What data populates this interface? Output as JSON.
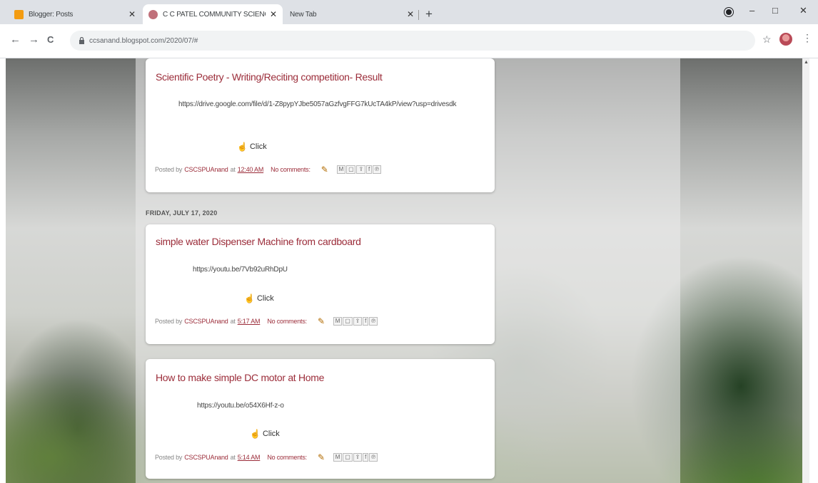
{
  "browser": {
    "tabs": [
      {
        "title": "Blogger: Posts",
        "favicon_color": "#f39c12",
        "active": false
      },
      {
        "title": "C C PATEL COMMUNITY SCIENC",
        "favicon_color": "#c0707a",
        "active": true
      },
      {
        "title": "New Tab",
        "favicon_color": "",
        "active": false
      }
    ],
    "new_tab_label": "+",
    "window_controls": {
      "minimize": "–",
      "maximize": "□",
      "close": "✕"
    },
    "url": "ccsanand.blogspot.com/2020/07/#"
  },
  "nav": {
    "back": "←",
    "forward": "→",
    "reload": "C",
    "bookmark": "☆",
    "menu": "⋮"
  },
  "blog": {
    "date_header": "FRIDAY, JULY 17, 2020",
    "posts": [
      {
        "title": "Scientific Poetry - Writing/Reciting competition- Result",
        "link": "https://drive.google.com/file/d/1-Z8pypYJbe5057aGzfvgFFG7kUcTA4kP/view?usp=drivesdk",
        "click_label": "Click",
        "posted_by": "Posted by",
        "author": "CSCSPUAnand",
        "at": "at",
        "time": "12:40 AM",
        "comments": "No comments:"
      },
      {
        "title": "simple water Dispenser Machine from cardboard",
        "link": "https://youtu.be/7Vb92uRhDpU",
        "click_label": "Click",
        "posted_by": "Posted by",
        "author": "CSCSPUAnand",
        "at": "at",
        "time": "5:17 AM",
        "comments": "No comments:"
      },
      {
        "title": "How to make simple DC motor at Home",
        "link": "https://youtu.be/o54X6Hf-z-o",
        "click_label": "Click",
        "posted_by": "Posted by",
        "author": "CSCSPUAnand",
        "at": "at",
        "time": "5:14 AM",
        "comments": "No comments:"
      }
    ],
    "share_buttons": [
      "M",
      "▢",
      "⇪",
      "f",
      "℗"
    ]
  }
}
